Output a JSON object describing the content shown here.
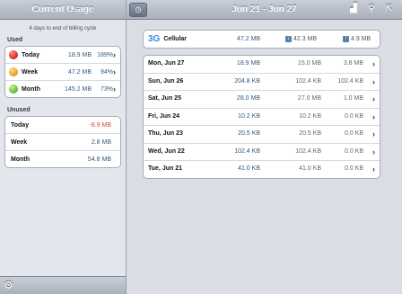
{
  "sidebar": {
    "title": "Current Usage",
    "note": "4 days to end of billing cycle",
    "used_label": "Used",
    "used": [
      {
        "label": "Today",
        "value": "18.9 MB",
        "pct": "189%",
        "color": "#d9342b"
      },
      {
        "label": "Week",
        "value": "47.2 MB",
        "pct": "94%",
        "color": "#f0a22e"
      },
      {
        "label": "Month",
        "value": "145.2 MB",
        "pct": "73%",
        "color": "#6cc139"
      }
    ],
    "unused_label": "Unused",
    "unused": [
      {
        "label": "Today",
        "value": "-8.9 MB",
        "negative": true
      },
      {
        "label": "Week",
        "value": "2.8 MB",
        "negative": false
      },
      {
        "label": "Month",
        "value": "54.8 MB",
        "negative": false
      }
    ]
  },
  "toolbar": {
    "date_range": "Jun 21 - Jun 27"
  },
  "cellular": {
    "badge": "3G",
    "label": "Cellular",
    "total": "47.2 MB",
    "down": "42.3 MB",
    "up": "4.9 MB"
  },
  "days": [
    {
      "name": "Mon, Jun 27",
      "total": "18.9 MB",
      "down": "15.0 MB",
      "up": "3.8 MB"
    },
    {
      "name": "Sun, Jun 26",
      "total": "204.8 KB",
      "down": "102.4 KB",
      "up": "102.4 KB"
    },
    {
      "name": "Sat, Jun 25",
      "total": "28.0 MB",
      "down": "27.0 MB",
      "up": "1.0 MB"
    },
    {
      "name": "Fri, Jun 24",
      "total": "10.2 KB",
      "down": "10.2 KB",
      "up": "0.0 KB"
    },
    {
      "name": "Thu, Jun 23",
      "total": "20.5 KB",
      "down": "20.5 KB",
      "up": "0.0 KB"
    },
    {
      "name": "Wed, Jun 22",
      "total": "102.4 KB",
      "down": "102.4 KB",
      "up": "0.0 KB"
    },
    {
      "name": "Tue, Jun 21",
      "total": "41.0 KB",
      "down": "41.0 KB",
      "up": "0.0 KB"
    }
  ]
}
